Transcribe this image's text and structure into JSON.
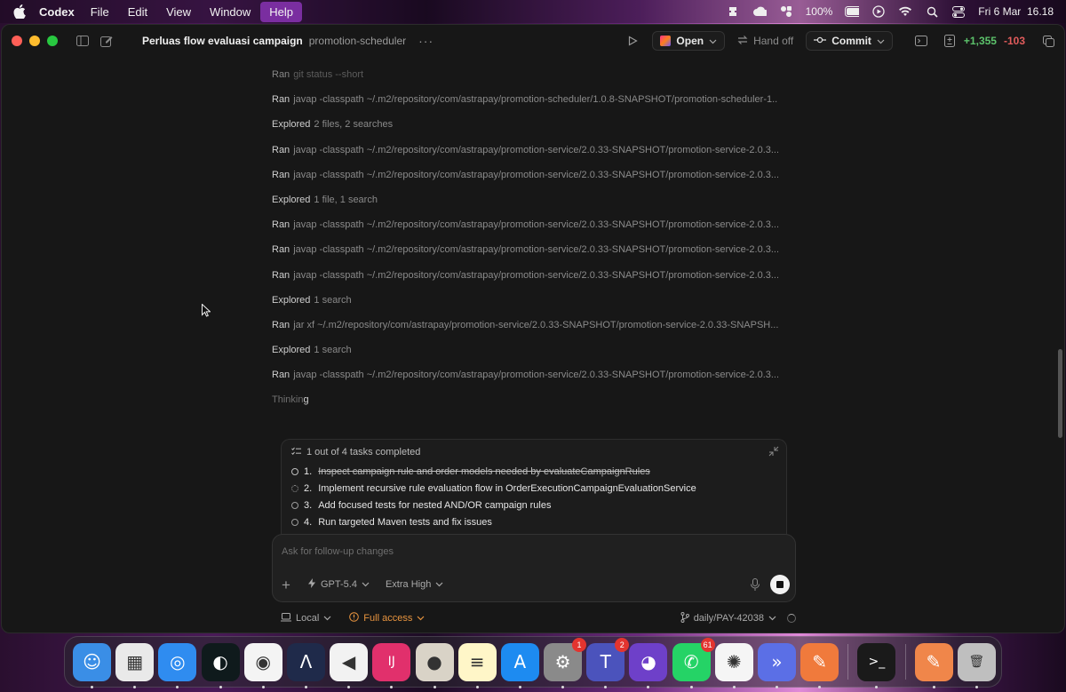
{
  "menubar": {
    "app": "Codex",
    "items": [
      "File",
      "Edit",
      "View",
      "Window",
      "Help"
    ],
    "battery": "100%",
    "datetime": "Fri 6 Mar  16.18"
  },
  "window": {
    "title": "Perluas flow evaluasi campaign",
    "project": "promotion-scheduler",
    "more": "···",
    "open_label": "Open",
    "handoff_label": "Hand off",
    "commit_label": "Commit",
    "additions": "+1,355",
    "deletions": "-103"
  },
  "log": [
    {
      "verb": "Ran",
      "text": "git status --short"
    },
    {
      "verb": "Ran",
      "text": "javap -classpath ~/.m2/repository/com/astrapay/promotion-scheduler/1.0.8-SNAPSHOT/promotion-scheduler-1...."
    },
    {
      "verb": "Explored",
      "text": "2 files, 2 searches"
    },
    {
      "verb": "Ran",
      "text": "javap -classpath ~/.m2/repository/com/astrapay/promotion-service/2.0.33-SNAPSHOT/promotion-service-2.0.3..."
    },
    {
      "verb": "Ran",
      "text": "javap -classpath ~/.m2/repository/com/astrapay/promotion-service/2.0.33-SNAPSHOT/promotion-service-2.0.3..."
    },
    {
      "verb": "Explored",
      "text": "1 file, 1 search"
    },
    {
      "verb": "Ran",
      "text": "javap -classpath ~/.m2/repository/com/astrapay/promotion-service/2.0.33-SNAPSHOT/promotion-service-2.0.3..."
    },
    {
      "verb": "Ran",
      "text": "javap -classpath ~/.m2/repository/com/astrapay/promotion-service/2.0.33-SNAPSHOT/promotion-service-2.0.3..."
    },
    {
      "verb": "Ran",
      "text": "javap -classpath ~/.m2/repository/com/astrapay/promotion-service/2.0.33-SNAPSHOT/promotion-service-2.0.3..."
    },
    {
      "verb": "Explored",
      "text": "1 search"
    },
    {
      "verb": "Ran",
      "text": "jar xf ~/.m2/repository/com/astrapay/promotion-service/2.0.33-SNAPSHOT/promotion-service-2.0.33-SNAPSH..."
    },
    {
      "verb": "Explored",
      "text": "1 search"
    },
    {
      "verb": "Ran",
      "text": "javap -classpath ~/.m2/repository/com/astrapay/promotion-service/2.0.33-SNAPSHOT/promotion-service-2.0.3..."
    }
  ],
  "thinking": {
    "dim": "Thinkin",
    "bright": "g"
  },
  "tasks": {
    "header": "1 out of 4 tasks completed",
    "items": [
      {
        "num": "1.",
        "text": "Inspect campaign rule and order models needed by evaluateCampaignRules",
        "status": "done"
      },
      {
        "num": "2.",
        "text": "Implement recursive rule evaluation flow in OrderExecutionCampaignEvaluationService",
        "status": "active"
      },
      {
        "num": "3.",
        "text": "Add focused tests for nested AND/OR campaign rules",
        "status": "pending"
      },
      {
        "num": "4.",
        "text": "Run targeted Maven tests and fix issues",
        "status": "pending"
      }
    ]
  },
  "composer": {
    "placeholder": "Ask for follow-up changes",
    "model": "GPT-5.4",
    "effort": "Extra High"
  },
  "footer": {
    "local": "Local",
    "access": "Full access",
    "branch": "daily/PAY-42038"
  },
  "dock": [
    {
      "name": "finder-icon",
      "bg": "#3a8ee6",
      "glyph": "☺"
    },
    {
      "name": "launchpad-icon",
      "bg": "#e9e9e9",
      "glyph": "▦"
    },
    {
      "name": "safari-icon",
      "bg": "#2f8cf0",
      "glyph": "◎"
    },
    {
      "name": "codex-app-icon",
      "bg": "#0f1a1c",
      "glyph": "◐"
    },
    {
      "name": "chrome-icon",
      "bg": "#f4f4f4",
      "glyph": "◉"
    },
    {
      "name": "arc-icon",
      "bg": "#1f2a4a",
      "glyph": "Λ"
    },
    {
      "name": "vscode-icon",
      "bg": "#f2f2f2",
      "glyph": "◀"
    },
    {
      "name": "intellij-icon",
      "bg": "#e1306c",
      "glyph": "IJ"
    },
    {
      "name": "postman-icon",
      "bg": "#d9d3c7",
      "glyph": "●"
    },
    {
      "name": "notes-icon",
      "bg": "#fff6c8",
      "glyph": "≡"
    },
    {
      "name": "app-store-icon",
      "bg": "#1d8bf1",
      "glyph": "A"
    },
    {
      "name": "system-settings-icon",
      "bg": "#8a8a8a",
      "glyph": "⚙",
      "badge": "1"
    },
    {
      "name": "teams-icon",
      "bg": "#4b53bc",
      "glyph": "T",
      "badge": "2"
    },
    {
      "name": "github-icon",
      "bg": "#6e40c9",
      "glyph": "◕"
    },
    {
      "name": "whatsapp-icon",
      "bg": "#25d366",
      "glyph": "✆",
      "badge": "61"
    },
    {
      "name": "chatgpt-icon",
      "bg": "#f5f5f5",
      "glyph": "✺"
    },
    {
      "name": "messages-icon",
      "bg": "#5b6fe6",
      "glyph": "»"
    },
    {
      "name": "pencil-app-icon",
      "bg": "#f07a3c",
      "glyph": "✎"
    },
    {
      "name": "terminal-icon",
      "bg": "#1a1a1a",
      "glyph": ">_"
    },
    {
      "name": "pages-icon",
      "bg": "#f0864a",
      "glyph": "✎"
    },
    {
      "name": "trash-icon",
      "bg": "#bfbfbf",
      "glyph": "🗑"
    }
  ],
  "colors": {
    "accent_orange": "#e8943f",
    "diff_add": "#5cc26b",
    "diff_del": "#e25c5c",
    "badge_red": "#e3342f"
  }
}
